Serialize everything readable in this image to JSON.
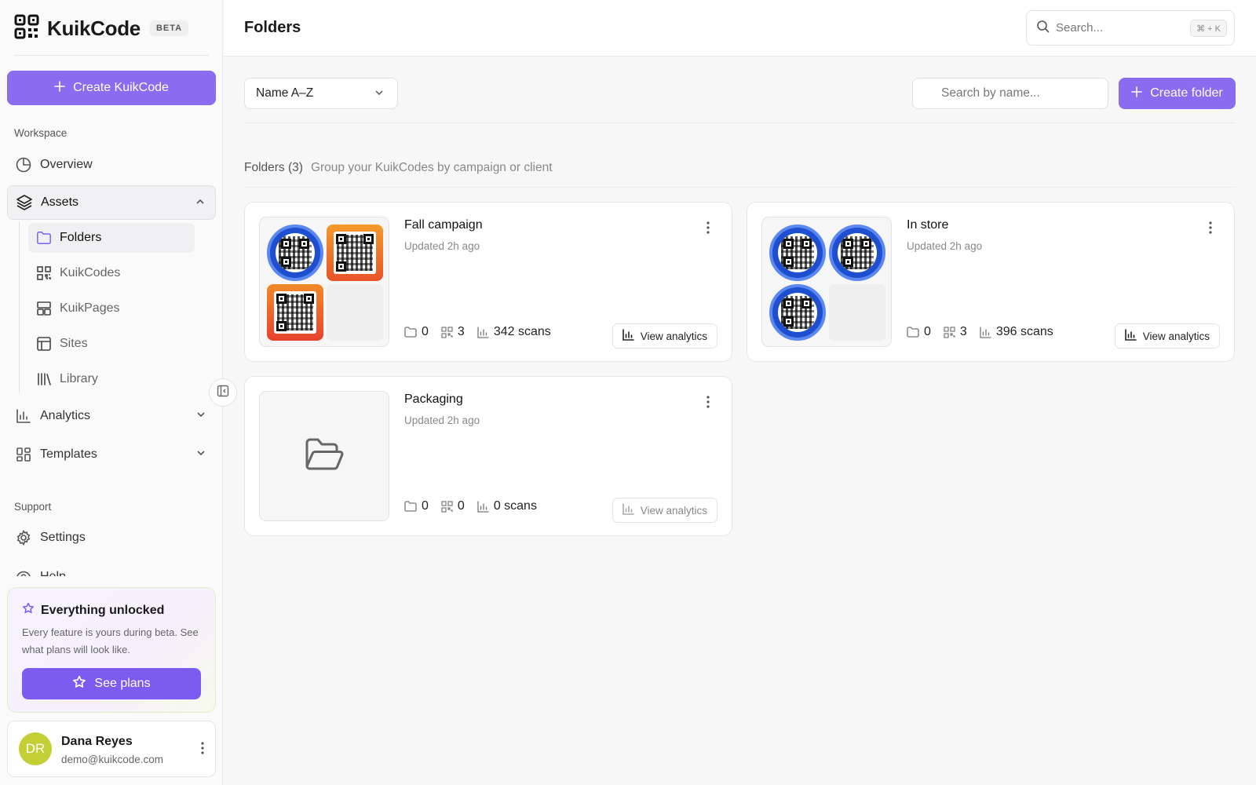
{
  "brand": {
    "name": "KuikCode",
    "badge": "BETA",
    "create_label": "Create KuikCode"
  },
  "sidebar": {
    "workspace_label": "Workspace",
    "overview": "Overview",
    "assets": "Assets",
    "assets_items": [
      "Folders",
      "KuikCodes",
      "KuikPages",
      "Sites",
      "Library"
    ],
    "analytics": "Analytics",
    "templates": "Templates",
    "support_label": "Support",
    "settings": "Settings",
    "help": "Help"
  },
  "promo": {
    "title": "Everything unlocked",
    "text": "Every feature is yours during beta. See what plans will look like.",
    "button": "See plans"
  },
  "user": {
    "initials": "DR",
    "name": "Dana Reyes",
    "email": "demo@kuikcode.com"
  },
  "header": {
    "title": "Folders",
    "search_placeholder": "Search...",
    "shortcut": "⌘ + K"
  },
  "toolbar": {
    "sort_value": "Name A–Z",
    "search_placeholder": "Search by name...",
    "create_folder": "Create folder"
  },
  "folders_section": {
    "count_label": "Folders (3)",
    "description": "Group your KuikCodes by campaign or client"
  },
  "folders": [
    {
      "name": "Fall campaign",
      "updated": "Updated 2h ago",
      "subfolders": "0",
      "codes": "3",
      "scans": "342 scans",
      "action": "View analytics"
    },
    {
      "name": "In store",
      "updated": "Updated 2h ago",
      "subfolders": "0",
      "codes": "3",
      "scans": "396 scans",
      "action": "View analytics"
    },
    {
      "name": "Packaging",
      "updated": "Updated 2h ago",
      "subfolders": "0",
      "codes": "0",
      "scans": "0 scans",
      "action": "View analytics"
    }
  ],
  "colors": {
    "accent": "#8b6cf0",
    "accent_dark": "#7c5cf0",
    "avatar": "#c3cf35",
    "qr_blue": "#1e4fd0",
    "qr_orange": "#f39a2c"
  }
}
